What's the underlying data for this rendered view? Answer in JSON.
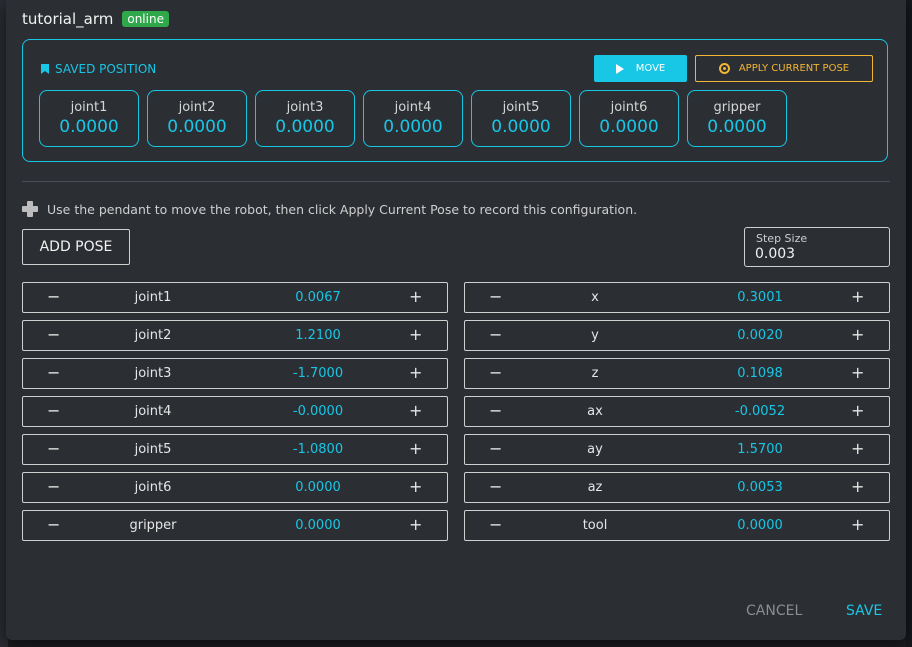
{
  "colors": {
    "accent": "#18c6e6",
    "warning": "#f2b534",
    "online": "#2ea84a",
    "dialog_bg": "#2b2e33"
  },
  "header": {
    "robot_name": "tutorial_arm",
    "status": "online"
  },
  "saved_position": {
    "title": "SAVED POSITION",
    "move_label": "MOVE",
    "apply_label": "APPLY CURRENT POSE",
    "joints": [
      {
        "label": "joint1",
        "value": "0.0000"
      },
      {
        "label": "joint2",
        "value": "0.0000"
      },
      {
        "label": "joint3",
        "value": "0.0000"
      },
      {
        "label": "joint4",
        "value": "0.0000"
      },
      {
        "label": "joint5",
        "value": "0.0000"
      },
      {
        "label": "joint6",
        "value": "0.0000"
      },
      {
        "label": "gripper",
        "value": "0.0000"
      }
    ]
  },
  "instructions": "Use the pendant to move the robot, then click Apply Current Pose to record this configuration.",
  "add_pose_label": "ADD POSE",
  "step_size": {
    "label": "Step Size",
    "value": "0.003"
  },
  "joint_controls": [
    {
      "name": "joint1",
      "value": "0.0067"
    },
    {
      "name": "joint2",
      "value": "1.2100"
    },
    {
      "name": "joint3",
      "value": "-1.7000"
    },
    {
      "name": "joint4",
      "value": "-0.0000"
    },
    {
      "name": "joint5",
      "value": "-1.0800"
    },
    {
      "name": "joint6",
      "value": "0.0000"
    },
    {
      "name": "gripper",
      "value": "0.0000"
    }
  ],
  "cartesian_controls": [
    {
      "name": "x",
      "value": "0.3001"
    },
    {
      "name": "y",
      "value": "0.0020"
    },
    {
      "name": "z",
      "value": "0.1098"
    },
    {
      "name": "ax",
      "value": "-0.0052"
    },
    {
      "name": "ay",
      "value": "1.5700"
    },
    {
      "name": "az",
      "value": "0.0053"
    },
    {
      "name": "tool",
      "value": "0.0000"
    }
  ],
  "minus_symbol": "−",
  "plus_symbol": "+",
  "footer": {
    "cancel_label": "CANCEL",
    "save_label": "SAVE"
  },
  "icons": {
    "saved": "bookmark-icon",
    "move": "play-icon",
    "apply": "crosshair-target-icon",
    "info": "gamepad-icon"
  }
}
